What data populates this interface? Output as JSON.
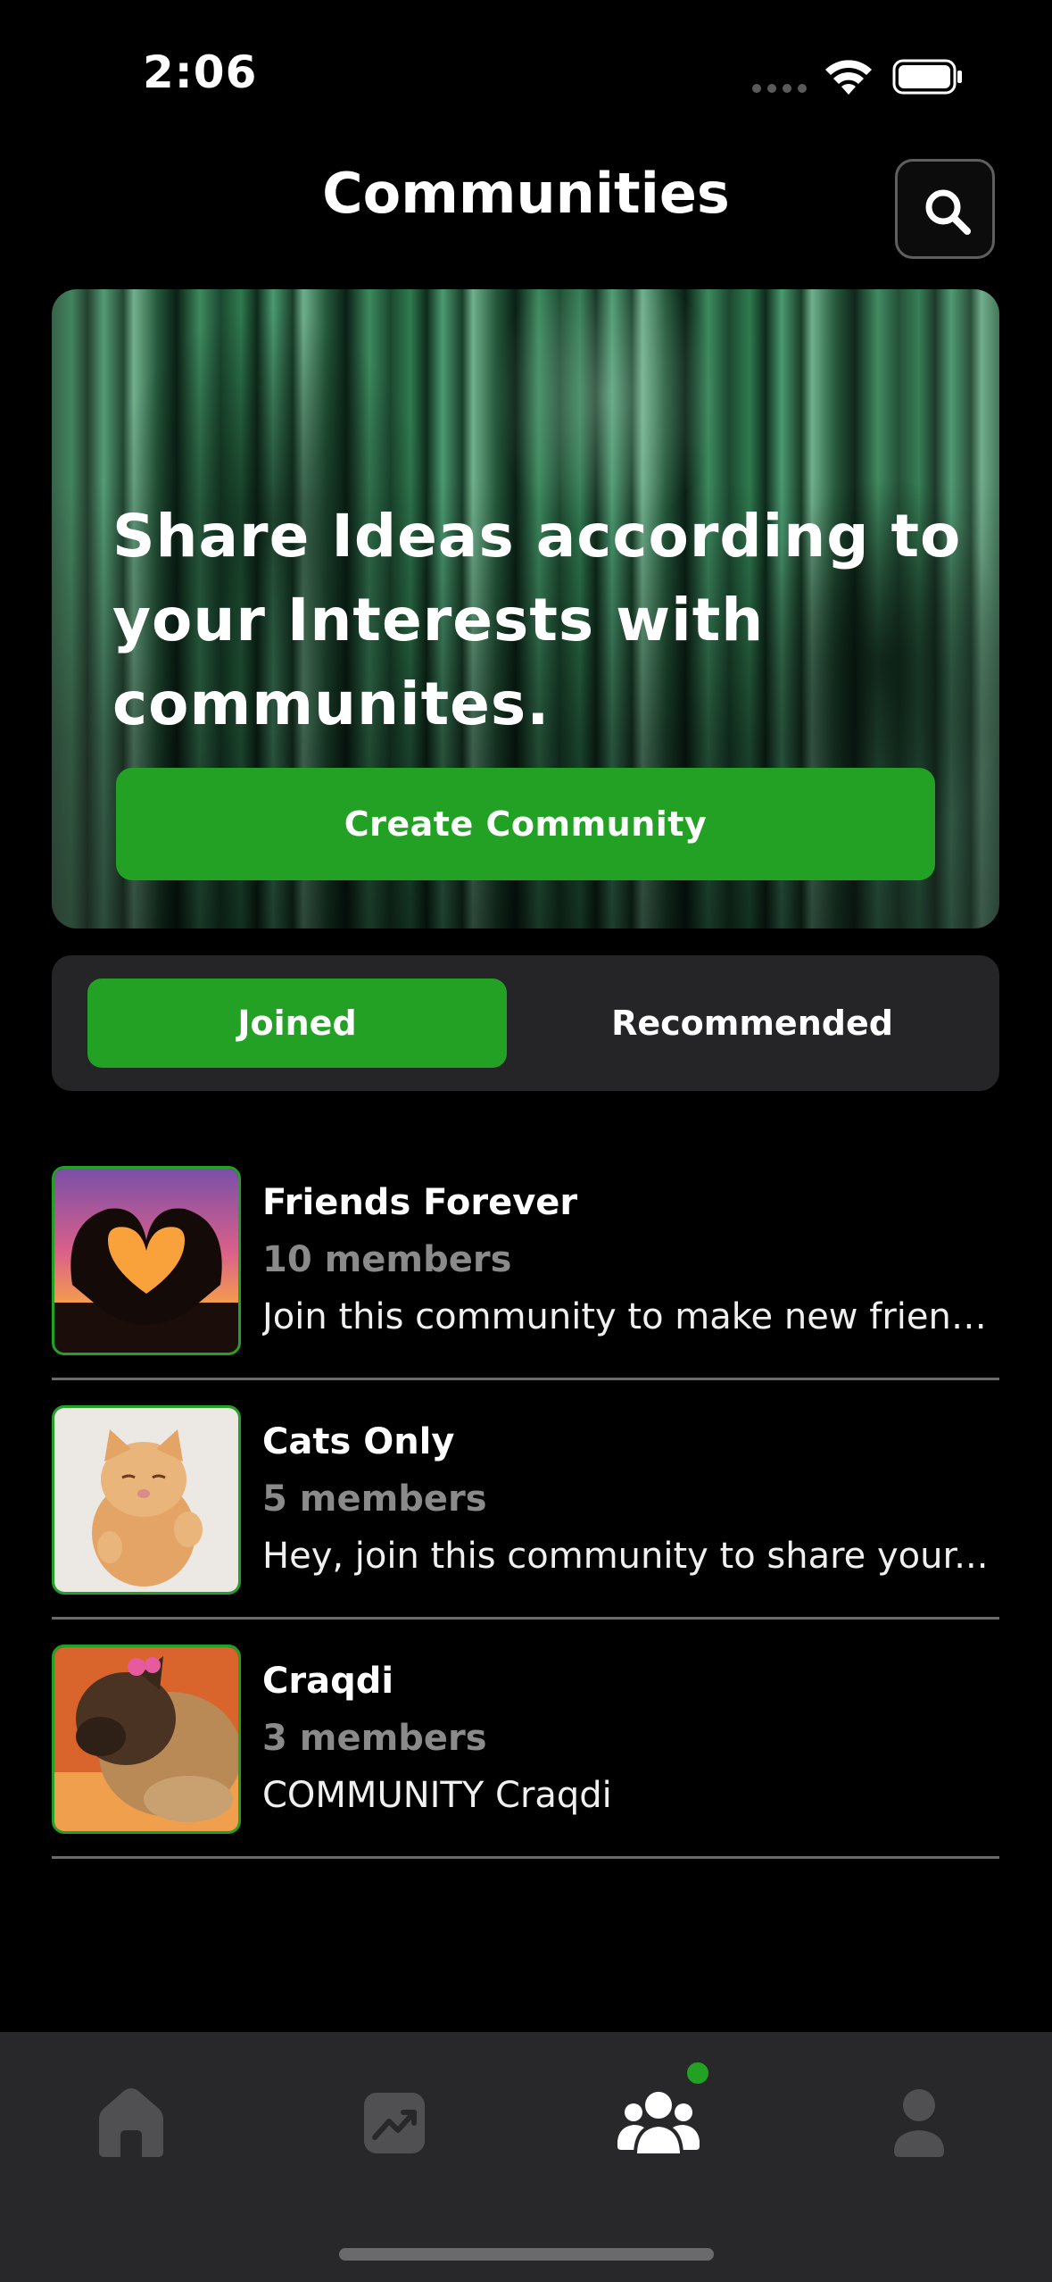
{
  "status_bar": {
    "time": "2:06"
  },
  "header": {
    "title": "Communities",
    "search_icon": "search-icon"
  },
  "hero": {
    "heading": "Share Ideas according to your Interests with communites.",
    "create_button_label": "Create Community"
  },
  "tabs": [
    {
      "label": "Joined",
      "selected": true
    },
    {
      "label": "Recommended",
      "selected": false
    }
  ],
  "communities": [
    {
      "name": "Friends Forever",
      "members": "10 members",
      "description": "Join this community to make new friend...",
      "thumbnail": "heart-hands-sunset-image"
    },
    {
      "name": "Cats Only",
      "members": "5 members",
      "description": "Hey, join this community to share your...",
      "thumbnail": "kitten-image"
    },
    {
      "name": "Craqdi",
      "members": "3 members",
      "description": "COMMUNITY Craqdi",
      "thumbnail": "dog-image"
    }
  ],
  "bottom_nav": {
    "items": [
      {
        "icon": "home-icon",
        "active": false
      },
      {
        "icon": "trending-icon",
        "active": false
      },
      {
        "icon": "communities-icon",
        "active": true
      },
      {
        "icon": "profile-icon",
        "active": false
      }
    ]
  },
  "colors": {
    "accent": "#22a125",
    "background": "#000000",
    "surface": "#252527",
    "muted_text": "#8a8a8a"
  }
}
